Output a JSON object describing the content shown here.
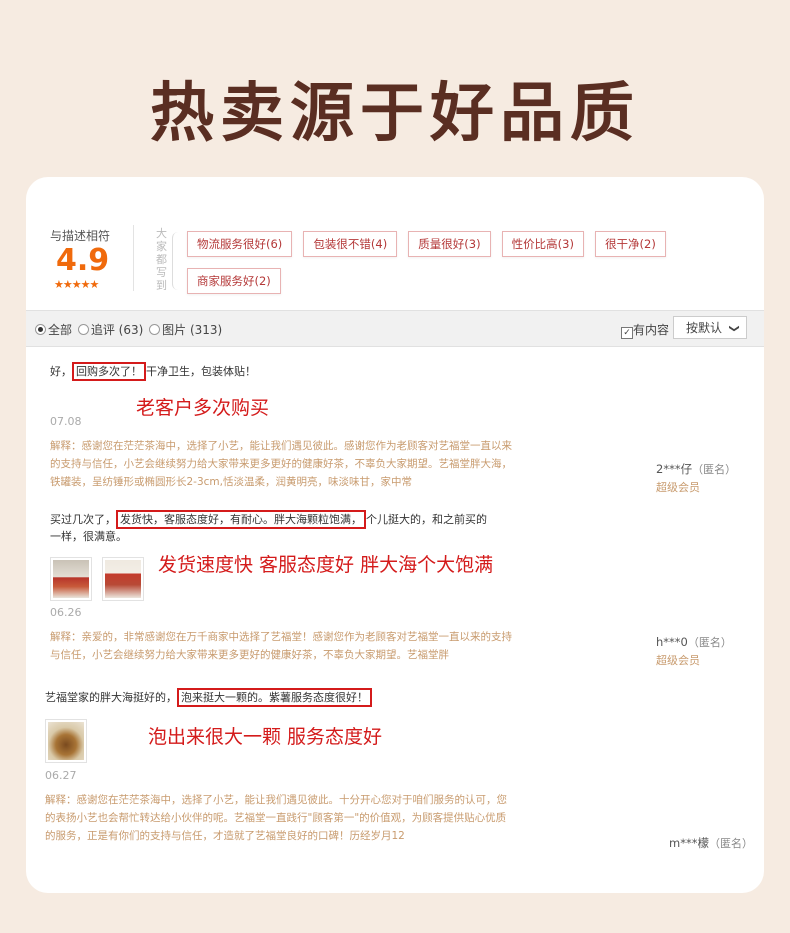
{
  "headline": "热卖源于好品质",
  "rating": {
    "label": "与描述相符",
    "score": "4.9",
    "stars": "★★★★★",
    "vertical_label": "大家都写到",
    "tags": [
      "物流服务很好(6)",
      "包装很不错(4)",
      "质量很好(3)",
      "性价比高(3)",
      "很干净(2)",
      "商家服务好(2)"
    ]
  },
  "filter": {
    "options": [
      "全部",
      "追评 (63)",
      "图片 (313)"
    ],
    "has_content_label": "有内容",
    "sort_label": "按默认",
    "sort_chevron": "❯"
  },
  "reviews": [
    {
      "text_pre": "好，",
      "text_highlight": "回购多次了！",
      "text_post": "干净卫生，包装体贴！",
      "annotation": "老客户多次购买",
      "date": "07.08",
      "reply": "解释：感谢您在茫茫茶海中，选择了小艺，能让我们遇见彼此。感谢您作为老顾客对艺福堂一直以来的支持与信任，小艺会继续努力给大家带来更多更好的健康好茶，不辜负大家期望。艺福堂胖大海，铁罐装，呈纺锤形或椭圆形长2-3cm,恬淡温柔，润黄明亮，味淡味甘，家中常",
      "user": "2***仔",
      "anon": "（匿名）",
      "member": "超级会员"
    },
    {
      "text_pre": "买过几次了，",
      "text_highlight": "发货快，客服态度好，有耐心。胖大海颗粒饱满，",
      "text_post": "个儿挺大的，和之前买的一样，很满意。",
      "annotation": "发货速度快 客服态度好 胖大海个大饱满",
      "date": "06.26",
      "reply": "解释：亲爱的，非常感谢您在万千商家中选择了艺福堂！感谢您作为老顾客对艺福堂一直以来的支持与信任，小艺会继续努力给大家带来更多更好的健康好茶，不辜负大家期望。艺福堂胖",
      "user": "h***0",
      "anon": "（匿名）",
      "member": "超级会员"
    },
    {
      "text_pre": "艺福堂家的胖大海挺好的，",
      "text_highlight": "泡来挺大一颗的。紫薯服务态度很好！",
      "text_post": "",
      "annotation": "泡出来很大一颗 服务态度好",
      "date": "06.27",
      "reply": "解释：感谢您在茫茫茶海中，选择了小艺，能让我们遇见彼此。十分开心您对于咱们服务的认可，您的表扬小艺也会帮忙转达给小伙伴的呢。艺福堂一直践行\"顾客第一\"的价值观，为顾客提供贴心优质的服务，正是有你们的支持与信任，才造就了艺福堂良好的口碑！历经岁月12",
      "user": "m***檬",
      "anon": "（匿名）",
      "member": ""
    }
  ],
  "colors": {
    "headline": "#5a2e22",
    "annotation": "#d41b1b",
    "tag_text": "#b43838",
    "score": "#f06a0c",
    "reply": "#c89b6e"
  },
  "icons": [
    "radio-icon",
    "checkbox-icon",
    "chevron-down-icon",
    "photo-thumbnail"
  ]
}
